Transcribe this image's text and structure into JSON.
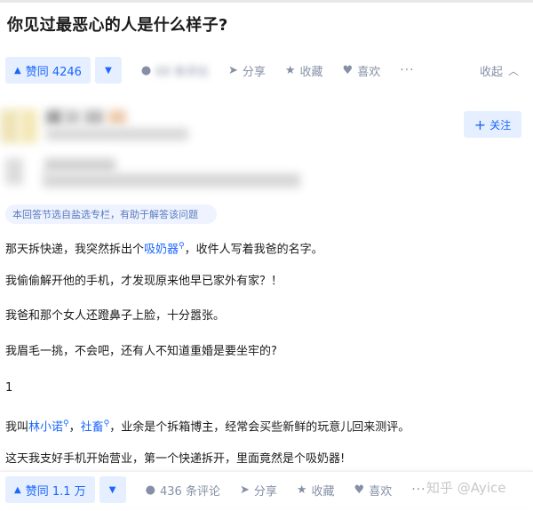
{
  "question": {
    "title": "你见过最恶心的人是什么样子?"
  },
  "top_actions": {
    "upvote": "赞同 4246",
    "comments": "69 条评论",
    "share": "分享",
    "favorite": "收藏",
    "like": "喜欢",
    "more": "···",
    "collapse": "收起"
  },
  "author": {
    "follow_label": "关注"
  },
  "source_tag": "本回答节选自盐选专栏，有助于解答该问题",
  "paragraphs": [
    "那天拆快递，我突然拆出个吸奶器，收件人写着我爸的名字。",
    "我偷偷解开他的手机，才发现原来他早已家外有家？！",
    "我爸和那个女人还蹬鼻子上脸，十分嚣张。",
    "我眉毛一挑，不会吧，还有人不知道重婚是要坐牢的?",
    "1",
    "我叫林小诺，社畜，业余是个拆箱博主，经常会买些新鲜的玩意儿回来测评。",
    "这天我支好手机开始营业，第一个快递拆开，里面竟然是个吸奶器!"
  ],
  "para1": {
    "before": "那天拆快递，我突然拆出个",
    "link": "吸奶器",
    "after": "，收件人写着我爸的名字。"
  },
  "para6": {
    "before": "我叫",
    "link1": "林小诺",
    "mid": "，",
    "link2": "社畜",
    "after": "，业余是个拆箱博主，经常会买些新鲜的玩意儿回来测评。"
  },
  "bottom_actions": {
    "upvote": "赞同 1.1 万",
    "comments": "436 条评论",
    "share": "分享",
    "favorite": "收藏",
    "like": "喜欢",
    "more": "···"
  },
  "watermark": "知乎 @Ayice",
  "colors": {
    "accent": "#1a66ff",
    "accent_bg": "#e6efff",
    "muted": "#8590a6"
  }
}
